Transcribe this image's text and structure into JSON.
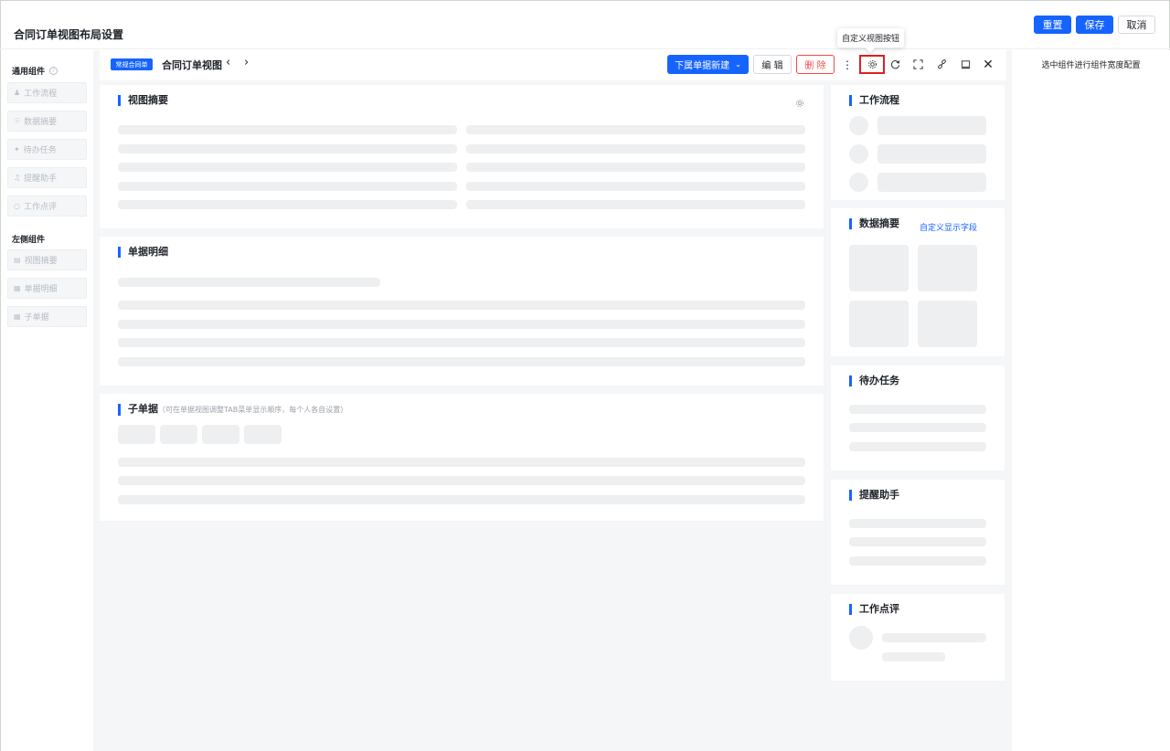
{
  "page": {
    "title": "合同订单视图布局设置"
  },
  "top_actions": {
    "reset": "重置",
    "save": "保存",
    "cancel": "取消"
  },
  "left_panel": {
    "general_title": "通用组件",
    "general_items": [
      {
        "label": "工作流程",
        "icon": "user-icon"
      },
      {
        "label": "数据摘要",
        "icon": "target-icon"
      },
      {
        "label": "待办任务",
        "icon": "pin-icon"
      },
      {
        "label": "提醒助手",
        "icon": "bell-icon"
      },
      {
        "label": "工作点评",
        "icon": "comment-icon"
      }
    ],
    "left_title": "左侧组件",
    "left_items": [
      {
        "label": "视图摘要",
        "icon": "layout-icon"
      },
      {
        "label": "单据明细",
        "icon": "box-icon"
      },
      {
        "label": "子单据",
        "icon": "grid-icon"
      }
    ]
  },
  "header": {
    "tag": "常规合同单",
    "title": "合同订单视图",
    "new_sub": "下属单据新建",
    "edit": "编 辑",
    "delete": "删 除"
  },
  "tooltip": "自定义视图按钮",
  "cards": {
    "summary": "视图摘要",
    "detail": "单据明细",
    "sub": "子单据",
    "sub_hint": "（可在单据视图调整TAB菜单显示顺序，每个人各自设置）",
    "workflow": "工作流程",
    "data_summary": "数据摘要",
    "custom_fields": "自定义显示字段",
    "todo": "待办任务",
    "reminder": "提醒助手",
    "review": "工作点评"
  },
  "right_panel": {
    "hint": "选中组件进行组件宽度配置"
  },
  "colors": {
    "primary": "#1664ff",
    "danger": "#f54a45",
    "highlight": "#e02020"
  }
}
